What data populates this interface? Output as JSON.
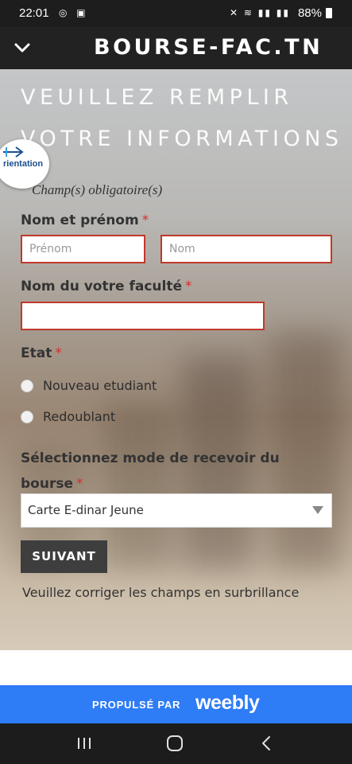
{
  "status_bar": {
    "time": "22:01",
    "left_icons": "messenger-icon image-icon",
    "right_icons": "mute wifi signal signal",
    "battery": "88%"
  },
  "header": {
    "menu_icon": "chevron-down-icon",
    "title": "BOURSE-FAC.TN"
  },
  "main": {
    "heading_line1": "VEUILLEZ REMPLIR",
    "heading_line2": "VOTRE INFORMATIONS",
    "logo_text": "rientation",
    "required_note": "Champ(s) obligatoire(s)",
    "form": {
      "name_label": "Nom et prénom",
      "first_name_placeholder": "Prénom",
      "last_name_placeholder": "Nom",
      "faculty_label": "Nom du votre faculté",
      "faculty_value": "",
      "etat_label": "Etat",
      "etat_options": [
        "Nouveau etudiant",
        "Redoublant"
      ],
      "mode_label": "Sélectionnez mode de recevoir du bourse",
      "mode_selected": "Carte E-dinar Jeune",
      "required_star": "*",
      "submit_label": "SUIVANT",
      "error_message": "Veuillez corriger les champs en surbrillance"
    }
  },
  "footer": {
    "powered_by": "PROPULSÉ PAR",
    "brand": "weebly"
  },
  "colors": {
    "header_bg": "#222222",
    "error_border": "#c0392b",
    "required_star": "#d32f2f",
    "footer_bg": "#2e7cf6",
    "button_bg": "#3e3e3e"
  }
}
